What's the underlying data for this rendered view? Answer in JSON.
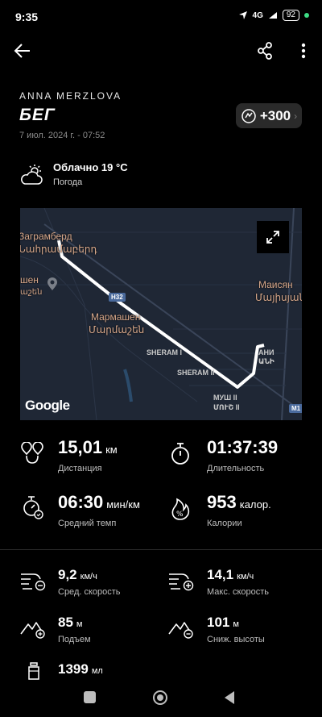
{
  "status": {
    "time": "9:35",
    "network": "4G",
    "battery": "92"
  },
  "header": {
    "back_icon": "arrow-left-icon",
    "share_icon": "share-icon",
    "menu_icon": "more-vertical-icon"
  },
  "activity": {
    "athlete": "ANNA MERZLOVA",
    "type": "БЕГ",
    "datetime": "7 июл. 2024 г. - 07:52",
    "points": "+300"
  },
  "weather": {
    "title": "Облачно 19 °C",
    "subtitle": "Погода",
    "icon": "cloud-sun-icon"
  },
  "map": {
    "labels": {
      "village1_ru": "Заграмберд",
      "village1_hy": "Նահրամաբերդ",
      "village2_ru": "Мармашен",
      "village2_hy": "Մարմաշեն",
      "village3_ru": "Маисян",
      "village3_hy": "Մայիսյան",
      "left_ru": "шен",
      "left_hy": "աշեն",
      "sheram1": "SHERAM I",
      "sheram2": "SHERAM II",
      "ani1": "АНИ",
      "ani2": "ԱՆԻ",
      "mush1": "МУШ II",
      "mush2": "ՄՈՒՇ II",
      "road": "H32",
      "road2": "M1",
      "provider": "Google"
    }
  },
  "stats": {
    "distance": {
      "value": "15,01",
      "unit": "км",
      "label": "Дистанция"
    },
    "duration": {
      "value": "01:37:39",
      "label": "Длительность"
    },
    "pace": {
      "value": "06:30",
      "unit": "мин/км",
      "label": "Средний темп"
    },
    "calories": {
      "value": "953",
      "unit": "калор.",
      "label": "Калории"
    }
  },
  "stats2": {
    "avg_speed": {
      "value": "9,2",
      "unit": "км/ч",
      "label": "Сред. скорость"
    },
    "max_speed": {
      "value": "14,1",
      "unit": "км/ч",
      "label": "Макс. скорость"
    },
    "ascent": {
      "value": "85",
      "unit": "м",
      "label": "Подъем"
    },
    "descent": {
      "value": "101",
      "unit": "м",
      "label": "Сниж. высоты"
    },
    "water": {
      "value": "1399",
      "unit": "мл"
    }
  },
  "colors": {
    "background": "#000000",
    "map_bg": "#1f2735",
    "route": "#ffffff",
    "badge_bg": "#2a2a2a"
  }
}
